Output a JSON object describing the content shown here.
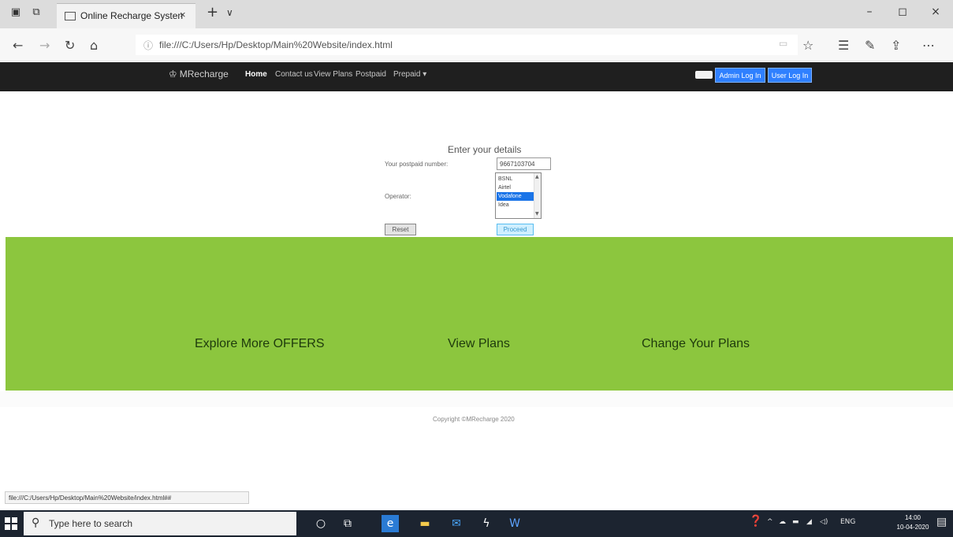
{
  "browser": {
    "tab_title": "Online Recharge Systen",
    "tab_close": "×",
    "new_tab": "+",
    "tab_menu": "∨",
    "url": "file:///C:/Users/Hp/Desktop/Main%20Website/index.html",
    "window_controls": [
      "–",
      "◻",
      "×"
    ]
  },
  "navbar": {
    "brand": "MRecharge",
    "items": [
      "Home",
      "Contact us",
      "View Plans",
      "Postpaid",
      "Prepaid ▾"
    ],
    "active_item": "Home",
    "admin_login": "Admin Log In",
    "user_login": "User Log In"
  },
  "form": {
    "title": "Enter your details",
    "number_label": "Your postpaid number:",
    "number_value": "9667103704",
    "operator_label": "Operator:",
    "operators": [
      "BSNL",
      "Airtel",
      "Vodafone",
      "Idea"
    ],
    "selected_operator": "Vodafone",
    "reset_label": "Reset",
    "proceed_label": "Proceed"
  },
  "band": {
    "links": [
      "Explore More OFFERS",
      "View Plans",
      "Change Your Plans"
    ],
    "color": "#8cc63e"
  },
  "footer": {
    "copyright": "Copyright ©MRecharge 2020"
  },
  "status_url": "file:///C:/Users/Hp/Desktop/Main%20Website/index.html##",
  "taskbar": {
    "search_placeholder": "Type here to search",
    "language": "ENG",
    "time": "14:00",
    "date": "10-04-2020"
  }
}
